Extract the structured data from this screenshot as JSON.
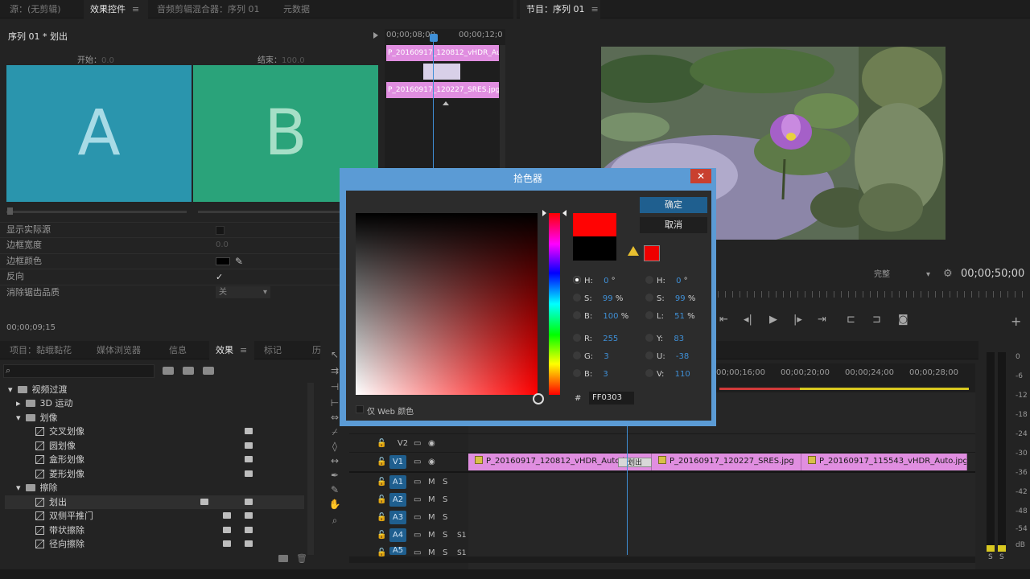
{
  "source_panel": {
    "tabs": [
      {
        "label": "源：(无剪辑)"
      },
      {
        "label": "效果控件"
      },
      {
        "label": "音频剪辑混合器：序列 01"
      },
      {
        "label": "元数据"
      }
    ],
    "sequence_title": "序列 01 * 划出",
    "start_label": "开始：",
    "start_value": "0.0",
    "end_label": "结束：",
    "end_value": "100.0",
    "preview_a": "A",
    "preview_b": "B",
    "timecode_start": "00;00;08;00",
    "timecode_end": "00;00;12;0",
    "clip1": "P_20160917_120812_vHDR_Auto.jpg",
    "clip2": "P_20160917_120227_SRES.jpg",
    "props": [
      {
        "label": "显示实际源"
      },
      {
        "label": "边框宽度",
        "value": "0.0"
      },
      {
        "label": "边框颜色"
      },
      {
        "label": "反向",
        "value": "✓"
      },
      {
        "label": "消除锯齿品质",
        "value": "关"
      }
    ],
    "footer_timecode": "00;00;09;15"
  },
  "program_panel": {
    "tab": "节目：序列 01",
    "fit_label": "完整",
    "timecode": "00;00;50;00"
  },
  "project_panel": {
    "tabs": [
      {
        "label": "项目：黏蛾黏花"
      },
      {
        "label": "媒体浏览器"
      },
      {
        "label": "信息"
      },
      {
        "label": "效果"
      },
      {
        "label": "标记"
      },
      {
        "label": "历"
      }
    ],
    "tree": [
      {
        "label": "视频过渡",
        "type": "folder",
        "level": 0,
        "open": true
      },
      {
        "label": "3D 运动",
        "type": "folder",
        "level": 1,
        "open": false
      },
      {
        "label": "划像",
        "type": "folder",
        "level": 1,
        "open": true
      },
      {
        "label": "交叉划像",
        "type": "fx",
        "level": 2
      },
      {
        "label": "圆划像",
        "type": "fx",
        "level": 2
      },
      {
        "label": "盒形划像",
        "type": "fx",
        "level": 2
      },
      {
        "label": "菱形划像",
        "type": "fx",
        "level": 2
      },
      {
        "label": "擦除",
        "type": "folder",
        "level": 1,
        "open": true
      },
      {
        "label": "划出",
        "type": "fx",
        "level": 2,
        "selected": true
      },
      {
        "label": "双侧平推门",
        "type": "fx",
        "level": 2
      },
      {
        "label": "带状擦除",
        "type": "fx",
        "level": 2
      },
      {
        "label": "径向擦除",
        "type": "fx",
        "level": 2
      }
    ]
  },
  "timeline": {
    "ruler": [
      "00;00;16;00",
      "00;00;20;00",
      "00;00;24;00",
      "00;00;28;00"
    ],
    "tracks": [
      {
        "label": "V2"
      },
      {
        "label": "V1"
      },
      {
        "label": "A1"
      },
      {
        "label": "A2"
      },
      {
        "label": "A3"
      },
      {
        "label": "A4"
      },
      {
        "label": "A5"
      }
    ],
    "mute_label": "M",
    "solo_label": "S",
    "s1": "S1",
    "clips": [
      {
        "label": "P_20160917_120812_vHDR_Auto.jpg"
      },
      {
        "label": "P_20160917_120227_SRES.jpg"
      },
      {
        "label": "P_20160917_115543_vHDR_Auto.jpg"
      }
    ],
    "transition_label": "划出"
  },
  "meter": {
    "labels": [
      "0",
      "-6",
      "-12",
      "-18",
      "-24",
      "-30",
      "-36",
      "-42",
      "-48",
      "-54",
      "dB"
    ],
    "solo": "S"
  },
  "color_picker": {
    "title": "拾色器",
    "ok": "确定",
    "cancel": "取消",
    "web_only": "仅 Web 颜色",
    "hex_label": "#",
    "hex": "FF0303",
    "hsb": [
      {
        "label": "H:",
        "value": "0",
        "unit": "°"
      },
      {
        "label": "S:",
        "value": "99",
        "unit": "%"
      },
      {
        "label": "B:",
        "value": "100",
        "unit": "%"
      }
    ],
    "hsl": [
      {
        "label": "H:",
        "value": "0",
        "unit": "°"
      },
      {
        "label": "S:",
        "value": "99",
        "unit": "%"
      },
      {
        "label": "L:",
        "value": "51",
        "unit": "%"
      }
    ],
    "rgb": [
      {
        "label": "R:",
        "value": "255"
      },
      {
        "label": "G:",
        "value": "3"
      },
      {
        "label": "B:",
        "value": "3"
      }
    ],
    "yuv": [
      {
        "label": "Y:",
        "value": "83"
      },
      {
        "label": "U:",
        "value": "-38"
      },
      {
        "label": "V:",
        "value": "110"
      }
    ],
    "new_color": "#ff0303",
    "old_color": "#000000"
  },
  "colors": {
    "accent": "#1f5f8f",
    "clip_pink": "#e08ee0",
    "playhead": "#3f8fd6",
    "preview_a": "#2a95ad",
    "preview_b": "#2aa37a"
  }
}
